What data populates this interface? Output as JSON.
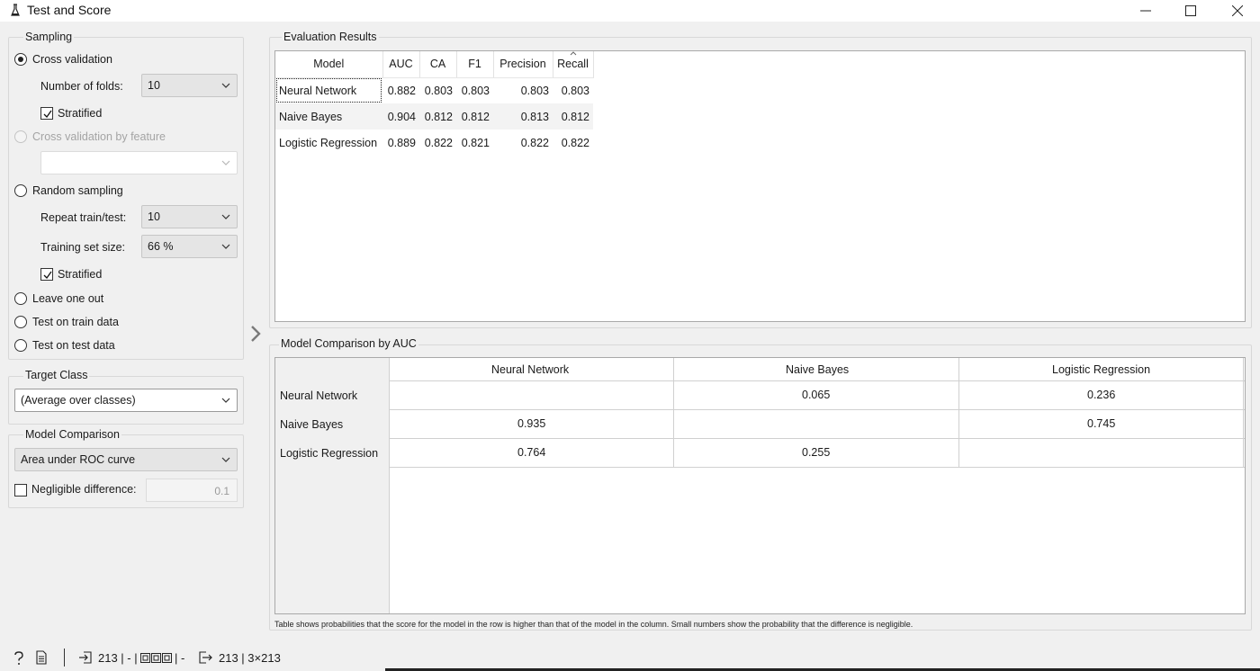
{
  "window": {
    "title": "Test and Score"
  },
  "sampling": {
    "title": "Sampling",
    "cross_validation": "Cross validation",
    "folds_label": "Number of folds:",
    "folds_value": "10",
    "stratified": "Stratified",
    "cv_by_feature": "Cross validation by feature",
    "cv_feature_value": "",
    "random_sampling": "Random sampling",
    "repeat_label": "Repeat train/test:",
    "repeat_value": "10",
    "train_size_label": "Training set size:",
    "train_size_value": "66 %",
    "stratified2": "Stratified",
    "leave_one_out": "Leave one out",
    "test_on_train": "Test on train data",
    "test_on_test": "Test on test data"
  },
  "target_class": {
    "title": "Target Class",
    "value": "(Average over classes)"
  },
  "model_comparison": {
    "title": "Model Comparison",
    "metric": "Area under ROC curve",
    "negligible_label": "Negligible difference:",
    "negligible_value": "0.1"
  },
  "evaluation": {
    "title": "Evaluation Results",
    "columns": [
      "Model",
      "AUC",
      "CA",
      "F1",
      "Precision",
      "Recall"
    ],
    "rows": [
      [
        "Neural Network",
        "0.882",
        "0.803",
        "0.803",
        "0.803",
        "0.803"
      ],
      [
        "Naive Bayes",
        "0.904",
        "0.812",
        "0.812",
        "0.813",
        "0.812"
      ],
      [
        "Logistic Regression",
        "0.889",
        "0.822",
        "0.821",
        "0.822",
        "0.822"
      ]
    ]
  },
  "comparison": {
    "title": "Model Comparison by AUC",
    "columns": [
      "Neural Network",
      "Naive Bayes",
      "Logistic Regression"
    ],
    "rows": [
      {
        "name": "Neural Network",
        "cells": [
          "",
          "0.065",
          "0.236"
        ]
      },
      {
        "name": "Naive Bayes",
        "cells": [
          "0.935",
          "",
          "0.745"
        ]
      },
      {
        "name": "Logistic Regression",
        "cells": [
          "0.764",
          "0.255",
          ""
        ]
      }
    ],
    "note": "Table shows probabilities that the score for the model in the row is higher than that of the model in the column. Small numbers show the probability that the difference is negligible."
  },
  "status": {
    "input_summary": "213 | - |",
    "input_suffix": "| -",
    "output_summary": "213 | 3×213"
  }
}
